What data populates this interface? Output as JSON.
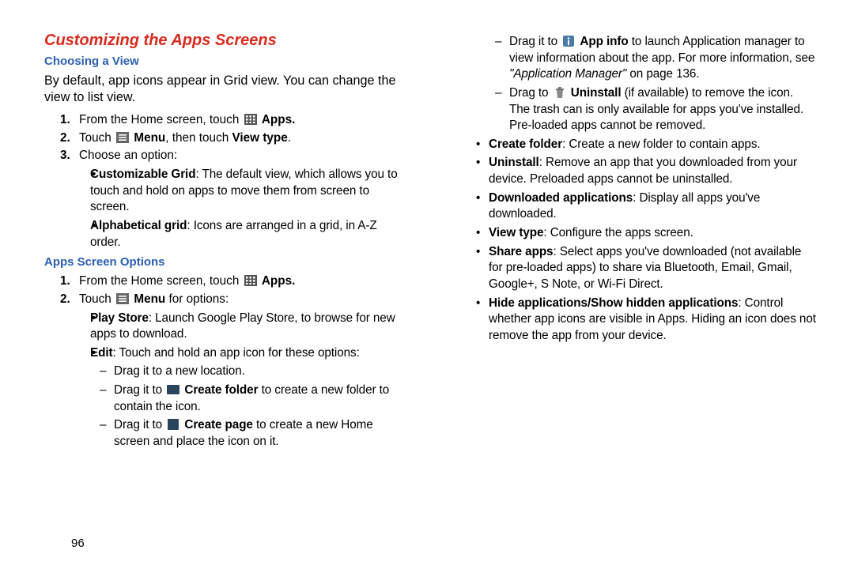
{
  "heading": "Customizing the Apps Screens",
  "sec1": {
    "title": "Choosing a View",
    "intro": "By default, app icons appear in Grid view. You can change the view to list view.",
    "s1a": "From the Home screen, touch ",
    "s1b": "Apps.",
    "s2a": "Touch ",
    "s2b": "Menu",
    "s2c": ", then touch ",
    "s2d": "View type",
    "s2e": ".",
    "s3": "Choose an option:",
    "b1a": "Customizable Grid",
    "b1b": ": The default view, which allows you to touch and hold on apps to move them from screen to screen.",
    "b2a": "Alphabetical grid",
    "b2b": ": Icons are arranged in a grid, in A-Z order."
  },
  "sec2": {
    "title": "Apps Screen Options",
    "s1a": "From the Home screen, touch ",
    "s1b": "Apps.",
    "s2a": "Touch ",
    "s2b": "Menu",
    "s2c": " for options:",
    "b1a": "Play Store",
    "b1b": ": Launch Google Play Store, to browse for new apps to download.",
    "b2a": "Edit",
    "b2b": ": Touch and hold an app icon for these options:",
    "d1": "Drag it to a new location.",
    "d2a": "Drag it to ",
    "d2b": "Create folder",
    "d2c": " to create a new folder to contain the icon.",
    "d3a": "Drag it to ",
    "d3b": "Create page",
    "d3c": " to create a new Home screen and place the icon on it."
  },
  "right": {
    "d4a": "Drag it to ",
    "d4b": "App info",
    "d4c": " to launch Application manager to view information about the app. For more information, see ",
    "d4d": "\"Application Manager\"",
    "d4e": " on page 136.",
    "d5a": "Drag to ",
    "d5b": "Uninstall",
    "d5c": " (if available) to remove the icon. The trash can is only available for apps you've installed. Pre-loaded apps cannot be removed.",
    "b3a": "Create folder",
    "b3b": ": Create a new folder to contain apps.",
    "b4a": "Uninstall",
    "b4b": ": Remove an app that you downloaded from your device. Preloaded apps cannot be uninstalled.",
    "b5a": "Downloaded applications",
    "b5b": ": Display all apps you've downloaded.",
    "b6a": "View type",
    "b6b": ": Configure the apps screen.",
    "b7a": "Share apps",
    "b7b": ": Select apps you've downloaded (not available for pre-loaded apps) to share via Bluetooth, Email, Gmail, Google+, S Note, or Wi-Fi Direct.",
    "b8a": "Hide applications/Show hidden applications",
    "b8b": ": Control whether app icons are visible in Apps. Hiding an icon does not remove the app from your device."
  },
  "page_number": "96"
}
